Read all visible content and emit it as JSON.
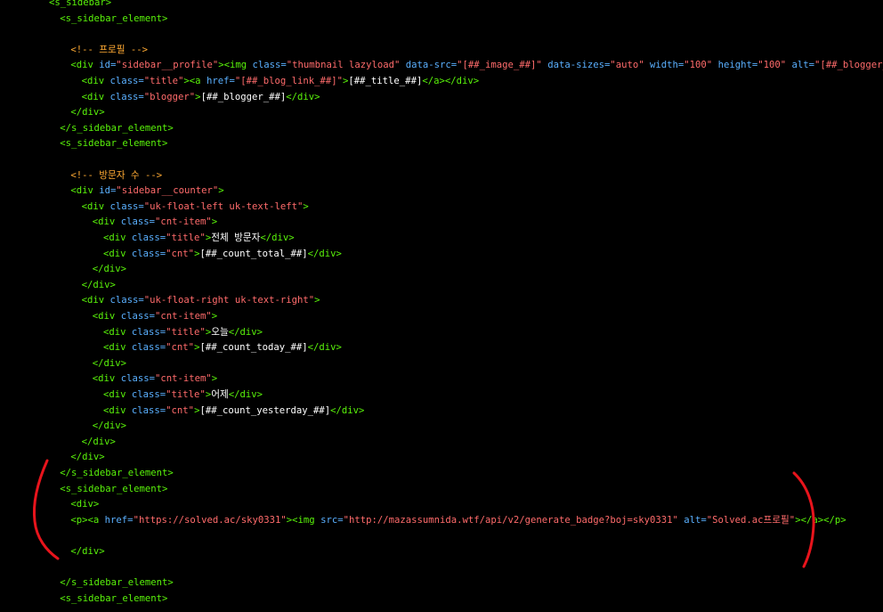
{
  "editor": {
    "lines": [
      {
        "indent": 0,
        "tokens": [
          {
            "t": "tag",
            "v": "<s_sidebar>"
          }
        ]
      },
      {
        "indent": 1,
        "tokens": [
          {
            "t": "tag",
            "v": "<s_sidebar_element>"
          }
        ]
      },
      {
        "indent": 1,
        "tokens": []
      },
      {
        "indent": 2,
        "tokens": [
          {
            "t": "cmt",
            "v": "<!-- 프로필 -->"
          }
        ]
      },
      {
        "indent": 2,
        "tokens": [
          {
            "t": "tag",
            "v": "<div "
          },
          {
            "t": "attr",
            "v": "id="
          },
          {
            "t": "str",
            "v": "\"sidebar__profile\""
          },
          {
            "t": "tag",
            "v": "><img "
          },
          {
            "t": "attr",
            "v": "class="
          },
          {
            "t": "str",
            "v": "\"thumbnail lazyload\""
          },
          {
            "t": "attr",
            "v": " data-src="
          },
          {
            "t": "str",
            "v": "\"[##_image_##]\""
          },
          {
            "t": "attr",
            "v": " data-sizes="
          },
          {
            "t": "str",
            "v": "\"auto\""
          },
          {
            "t": "attr",
            "v": " width="
          },
          {
            "t": "str",
            "v": "\"100\""
          },
          {
            "t": "attr",
            "v": " height="
          },
          {
            "t": "str",
            "v": "\"100\""
          },
          {
            "t": "attr",
            "v": " alt="
          },
          {
            "t": "str",
            "v": "\"[##_blogger_##]\""
          },
          {
            "t": "tag",
            "v": ">"
          }
        ]
      },
      {
        "indent": 3,
        "tokens": [
          {
            "t": "tag",
            "v": "<div "
          },
          {
            "t": "attr",
            "v": "class="
          },
          {
            "t": "str",
            "v": "\"title\""
          },
          {
            "t": "tag",
            "v": "><a "
          },
          {
            "t": "attr",
            "v": "href="
          },
          {
            "t": "str",
            "v": "\"[##_blog_link_##]\""
          },
          {
            "t": "tag",
            "v": ">"
          },
          {
            "t": "txt",
            "v": "[##_title_##]"
          },
          {
            "t": "tag",
            "v": "</a></div>"
          }
        ]
      },
      {
        "indent": 3,
        "tokens": [
          {
            "t": "tag",
            "v": "<div "
          },
          {
            "t": "attr",
            "v": "class="
          },
          {
            "t": "str",
            "v": "\"blogger\""
          },
          {
            "t": "tag",
            "v": ">"
          },
          {
            "t": "txt",
            "v": "[##_blogger_##]"
          },
          {
            "t": "tag",
            "v": "</div>"
          }
        ]
      },
      {
        "indent": 2,
        "tokens": [
          {
            "t": "tag",
            "v": "</div>"
          }
        ]
      },
      {
        "indent": 1,
        "tokens": [
          {
            "t": "tag",
            "v": "</s_sidebar_element>"
          }
        ]
      },
      {
        "indent": 1,
        "tokens": [
          {
            "t": "tag",
            "v": "<s_sidebar_element>"
          }
        ]
      },
      {
        "indent": 1,
        "tokens": []
      },
      {
        "indent": 2,
        "tokens": [
          {
            "t": "cmt",
            "v": "<!-- 방문자 수 -->"
          }
        ]
      },
      {
        "indent": 2,
        "tokens": [
          {
            "t": "tag",
            "v": "<div "
          },
          {
            "t": "attr",
            "v": "id="
          },
          {
            "t": "str",
            "v": "\"sidebar__counter\""
          },
          {
            "t": "tag",
            "v": ">"
          }
        ]
      },
      {
        "indent": 3,
        "tokens": [
          {
            "t": "tag",
            "v": "<div "
          },
          {
            "t": "attr",
            "v": "class="
          },
          {
            "t": "str",
            "v": "\"uk-float-left uk-text-left\""
          },
          {
            "t": "tag",
            "v": ">"
          }
        ]
      },
      {
        "indent": 4,
        "tokens": [
          {
            "t": "tag",
            "v": "<div "
          },
          {
            "t": "attr",
            "v": "class="
          },
          {
            "t": "str",
            "v": "\"cnt-item\""
          },
          {
            "t": "tag",
            "v": ">"
          }
        ]
      },
      {
        "indent": 5,
        "tokens": [
          {
            "t": "tag",
            "v": "<div "
          },
          {
            "t": "attr",
            "v": "class="
          },
          {
            "t": "str",
            "v": "\"title\""
          },
          {
            "t": "tag",
            "v": ">"
          },
          {
            "t": "txt",
            "v": "전체 방문자"
          },
          {
            "t": "tag",
            "v": "</div>"
          }
        ]
      },
      {
        "indent": 5,
        "tokens": [
          {
            "t": "tag",
            "v": "<div "
          },
          {
            "t": "attr",
            "v": "class="
          },
          {
            "t": "str",
            "v": "\"cnt\""
          },
          {
            "t": "tag",
            "v": ">"
          },
          {
            "t": "txt",
            "v": "[##_count_total_##]"
          },
          {
            "t": "tag",
            "v": "</div>"
          }
        ]
      },
      {
        "indent": 4,
        "tokens": [
          {
            "t": "tag",
            "v": "</div>"
          }
        ]
      },
      {
        "indent": 3,
        "tokens": [
          {
            "t": "tag",
            "v": "</div>"
          }
        ]
      },
      {
        "indent": 3,
        "tokens": [
          {
            "t": "tag",
            "v": "<div "
          },
          {
            "t": "attr",
            "v": "class="
          },
          {
            "t": "str",
            "v": "\"uk-float-right uk-text-right\""
          },
          {
            "t": "tag",
            "v": ">"
          }
        ]
      },
      {
        "indent": 4,
        "tokens": [
          {
            "t": "tag",
            "v": "<div "
          },
          {
            "t": "attr",
            "v": "class="
          },
          {
            "t": "str",
            "v": "\"cnt-item\""
          },
          {
            "t": "tag",
            "v": ">"
          }
        ]
      },
      {
        "indent": 5,
        "tokens": [
          {
            "t": "tag",
            "v": "<div "
          },
          {
            "t": "attr",
            "v": "class="
          },
          {
            "t": "str",
            "v": "\"title\""
          },
          {
            "t": "tag",
            "v": ">"
          },
          {
            "t": "txt",
            "v": "오늘"
          },
          {
            "t": "tag",
            "v": "</div>"
          }
        ]
      },
      {
        "indent": 5,
        "tokens": [
          {
            "t": "tag",
            "v": "<div "
          },
          {
            "t": "attr",
            "v": "class="
          },
          {
            "t": "str",
            "v": "\"cnt\""
          },
          {
            "t": "tag",
            "v": ">"
          },
          {
            "t": "txt",
            "v": "[##_count_today_##]"
          },
          {
            "t": "tag",
            "v": "</div>"
          }
        ]
      },
      {
        "indent": 4,
        "tokens": [
          {
            "t": "tag",
            "v": "</div>"
          }
        ]
      },
      {
        "indent": 4,
        "tokens": [
          {
            "t": "tag",
            "v": "<div "
          },
          {
            "t": "attr",
            "v": "class="
          },
          {
            "t": "str",
            "v": "\"cnt-item\""
          },
          {
            "t": "tag",
            "v": ">"
          }
        ]
      },
      {
        "indent": 5,
        "tokens": [
          {
            "t": "tag",
            "v": "<div "
          },
          {
            "t": "attr",
            "v": "class="
          },
          {
            "t": "str",
            "v": "\"title\""
          },
          {
            "t": "tag",
            "v": ">"
          },
          {
            "t": "txt",
            "v": "어제"
          },
          {
            "t": "tag",
            "v": "</div>"
          }
        ]
      },
      {
        "indent": 5,
        "tokens": [
          {
            "t": "tag",
            "v": "<div "
          },
          {
            "t": "attr",
            "v": "class="
          },
          {
            "t": "str",
            "v": "\"cnt\""
          },
          {
            "t": "tag",
            "v": ">"
          },
          {
            "t": "txt",
            "v": "[##_count_yesterday_##]"
          },
          {
            "t": "tag",
            "v": "</div>"
          }
        ]
      },
      {
        "indent": 4,
        "tokens": [
          {
            "t": "tag",
            "v": "</div>"
          }
        ]
      },
      {
        "indent": 3,
        "tokens": [
          {
            "t": "tag",
            "v": "</div>"
          }
        ]
      },
      {
        "indent": 2,
        "tokens": [
          {
            "t": "tag",
            "v": "</div>"
          }
        ]
      },
      {
        "indent": 1,
        "tokens": [
          {
            "t": "tag",
            "v": "</s_sidebar_element>"
          }
        ]
      },
      {
        "indent": 1,
        "tokens": [
          {
            "t": "tag",
            "v": "<s_sidebar_element>"
          }
        ]
      },
      {
        "indent": 2,
        "tokens": [
          {
            "t": "tag",
            "v": "<div>"
          }
        ]
      },
      {
        "indent": 2,
        "tokens": [
          {
            "t": "tag",
            "v": "<p><a "
          },
          {
            "t": "attr",
            "v": "href="
          },
          {
            "t": "str",
            "v": "\"https://solved.ac/sky0331\""
          },
          {
            "t": "tag",
            "v": "><img "
          },
          {
            "t": "attr",
            "v": "src="
          },
          {
            "t": "str",
            "v": "\"http://mazassumnida.wtf/api/v2/generate_badge?boj=sky0331\""
          },
          {
            "t": "attr",
            "v": " alt="
          },
          {
            "t": "str",
            "v": "\"Solved.ac프로필\""
          },
          {
            "t": "tag",
            "v": "></a></p>"
          }
        ]
      },
      {
        "indent": 2,
        "tokens": []
      },
      {
        "indent": 2,
        "tokens": [
          {
            "t": "tag",
            "v": "</div>"
          }
        ]
      },
      {
        "indent": 1,
        "tokens": []
      },
      {
        "indent": 1,
        "tokens": [
          {
            "t": "tag",
            "v": "</s_sidebar_element>"
          }
        ]
      },
      {
        "indent": 1,
        "tokens": [
          {
            "t": "tag",
            "v": "<s_sidebar_element>"
          }
        ]
      }
    ]
  },
  "colors": {
    "background": "#000000",
    "tag": "#59f20a",
    "attribute": "#5ab0ff",
    "string": "#ff6b6b",
    "text": "#ffffff",
    "comment": "#ffaa33",
    "annotation": "#e8141c"
  },
  "annotation": {
    "style": "hand-drawn-red-brackets"
  }
}
